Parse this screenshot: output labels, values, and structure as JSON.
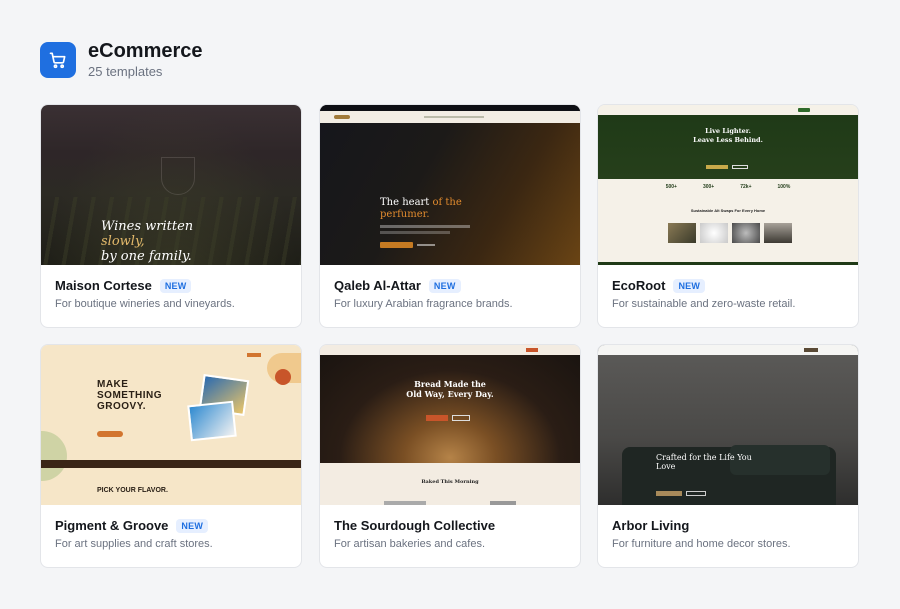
{
  "header": {
    "title": "eCommerce",
    "subtitle": "25 templates",
    "icon": "shopping-cart-icon"
  },
  "accent": "#1f6fe0",
  "cards": [
    {
      "name": "Maison Cortese",
      "badge": "NEW",
      "description": "For boutique wineries and vineyards.",
      "preview": {
        "headline_1": "Wines written",
        "headline_2": "slowly,",
        "headline_3": "by one family."
      }
    },
    {
      "name": "Qaleb Al-Attar",
      "badge": "NEW",
      "description": "For luxury Arabian fragrance brands.",
      "preview": {
        "headline_1": "The heart ",
        "headline_highlight": "of the",
        "headline_2": "perfumer."
      }
    },
    {
      "name": "EcoRoot",
      "badge": "NEW",
      "description": "For sustainable and zero-waste retail.",
      "preview": {
        "headline_1": "Live Lighter.",
        "headline_2": "Leave Less Behind.",
        "stats": [
          "500+",
          "300+",
          "72k+",
          "100%"
        ],
        "section_title": "Sustainable Alt Swaps For Every Home"
      }
    },
    {
      "name": "Pigment & Groove",
      "badge": "NEW",
      "description": "For art supplies and craft stores.",
      "preview": {
        "headline_1": "MAKE",
        "headline_2": "SOMETHING",
        "headline_3": "GROOVY.",
        "section_title": "PICK YOUR FLAVOR."
      }
    },
    {
      "name": "The Sourdough Collective",
      "badge": "",
      "description": "For artisan bakeries and cafes.",
      "preview": {
        "headline_1": "Bread Made the",
        "headline_2": "Old Way, Every Day.",
        "section_title": "Baked This Morning"
      }
    },
    {
      "name": "Arbor Living",
      "badge": "",
      "description": "For furniture and home decor stores.",
      "preview": {
        "headline_1": "Crafted for the Life You",
        "headline_2": "Love"
      }
    }
  ]
}
